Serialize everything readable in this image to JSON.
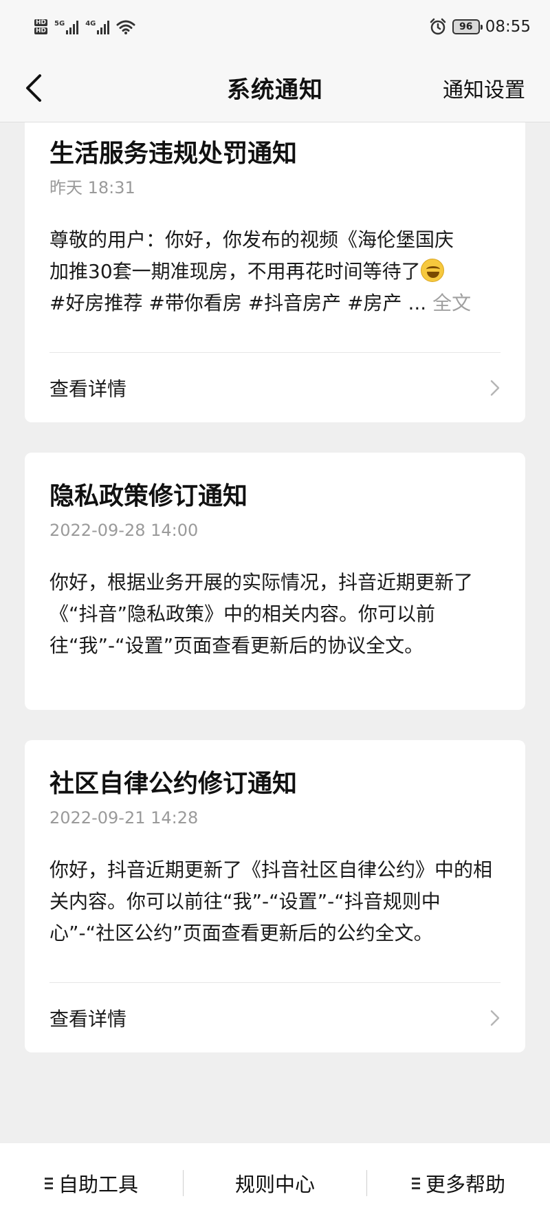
{
  "status_bar": {
    "hd_top": "HD",
    "hd_bottom": "HD",
    "net1": "5G",
    "net2": "4G",
    "battery": "96",
    "time": "08:55",
    "icons": [
      "alarm-icon",
      "wifi-icon",
      "signal-icon",
      "battery-icon"
    ]
  },
  "nav": {
    "title": "系统通知",
    "settings_label": "通知设置"
  },
  "cards": [
    {
      "title": "生活服务违规处罚通知",
      "time": "昨天 18:31",
      "body_line1": "尊敬的用户：你好，你发布的视频《海伦堡国庆",
      "body_line2": "加推30套一期准现房，不用再花时间等待了",
      "body_line3": "#好房推荐 #带你看房 #抖音房产 #房产 ...",
      "more_label": "全文",
      "footer_label": "查看详情"
    },
    {
      "title": "隐私政策修订通知",
      "time": "2022-09-28 14:00",
      "body": "你好，根据业务开展的实际情况，抖音近期更新了《“抖音”隐私政策》中的相关内容。你可以前往“我”-“设置”页面查看更新后的协议全文。"
    },
    {
      "title": "社区自律公约修订通知",
      "time": "2022-09-21 14:28",
      "body": "你好，抖音近期更新了《抖音社区自律公约》中的相关内容。你可以前往“我”-“设置”-“抖音规则中心”-“社区公约”页面查看更新后的公约全文。",
      "footer_label": "查看详情"
    }
  ],
  "bottom_bar": {
    "items": [
      "自助工具",
      "规则中心",
      "更多帮助"
    ]
  },
  "colors": {
    "page_bg": "#efefef",
    "card_bg": "#ffffff",
    "secondary_text": "#9a9a9a",
    "primary_text": "#111111"
  }
}
